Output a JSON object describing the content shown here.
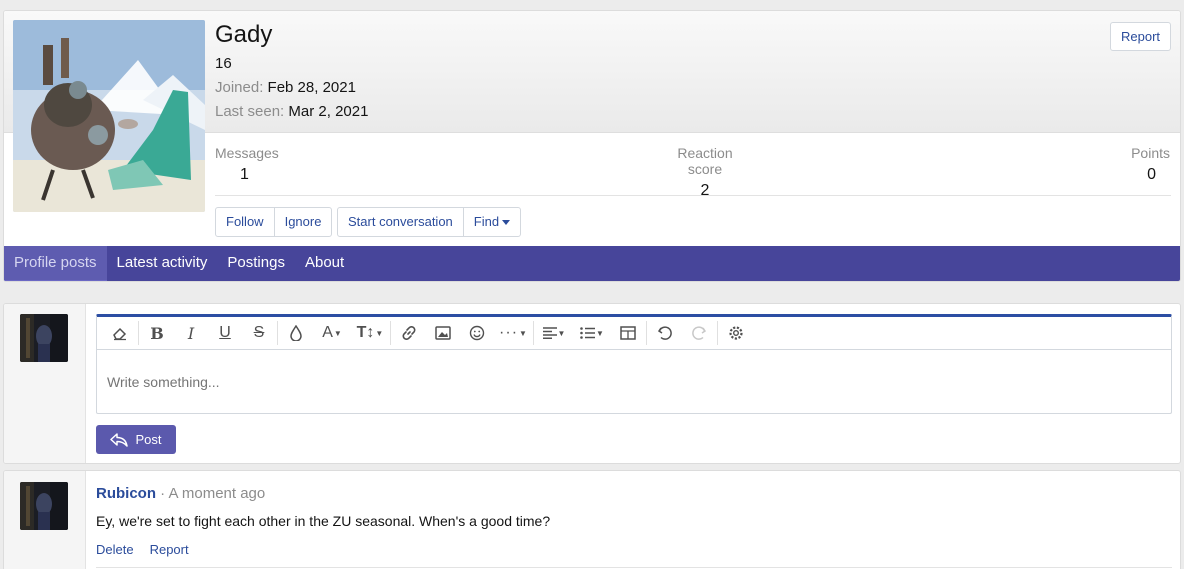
{
  "profile": {
    "username": "Gady",
    "user_title": "16",
    "joined_label": "Joined:",
    "joined_value": "Feb 28, 2021",
    "last_seen_label": "Last seen:",
    "last_seen_value": "Mar 2, 2021",
    "report_label": "Report",
    "stats": [
      {
        "label": "Messages",
        "value": "1"
      },
      {
        "label": "Reaction score",
        "value": "2"
      },
      {
        "label": "Points",
        "value": "0"
      }
    ],
    "actions": {
      "follow": "Follow",
      "ignore": "Ignore",
      "start_conversation": "Start conversation",
      "find": "Find"
    }
  },
  "tabs": [
    {
      "label": "Profile posts",
      "active": true
    },
    {
      "label": "Latest activity",
      "active": false
    },
    {
      "label": "Postings",
      "active": false
    },
    {
      "label": "About",
      "active": false
    }
  ],
  "editor": {
    "placeholder": "Write something...",
    "post_label": "Post",
    "toolbar_icons": [
      "eraser-icon",
      "bold-icon",
      "italic-icon",
      "underline-icon",
      "strikethrough-icon",
      "text-color-icon",
      "font-family-icon",
      "font-size-icon",
      "link-icon",
      "image-icon",
      "emoji-icon",
      "more-icon",
      "align-icon",
      "list-icon",
      "table-icon",
      "undo-icon",
      "redo-icon",
      "settings-icon"
    ]
  },
  "message": {
    "author": "Rubicon",
    "separator": "·",
    "time": "A moment ago",
    "body": "Ey, we're set to fight each other in the ZU seasonal. When's a good time?",
    "delete_label": "Delete",
    "report_label": "Report"
  },
  "colors": {
    "nav_bar": "#47459a",
    "active_tab": "#5e5cb0",
    "link": "#2b4c9b",
    "post_button": "#5b59ad",
    "editor_accent": "#2c4ea3"
  }
}
